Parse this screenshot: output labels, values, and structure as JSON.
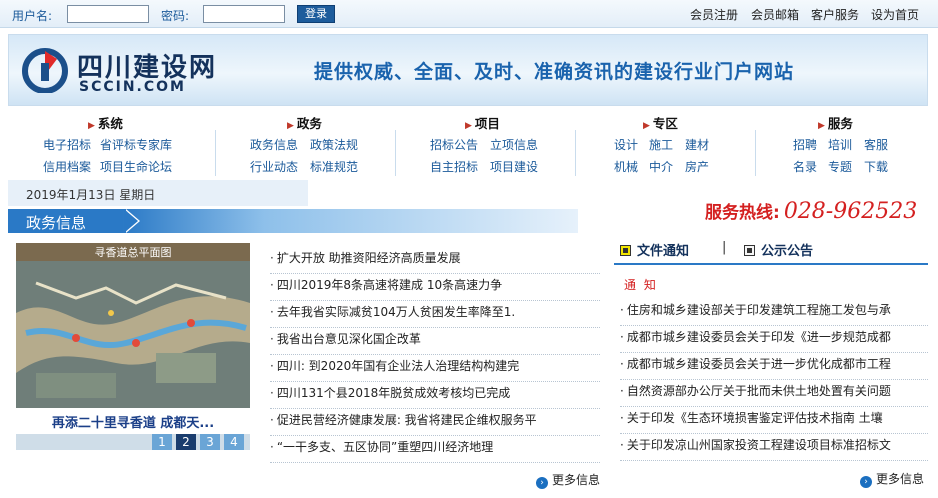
{
  "topbar": {
    "username_label": "用户名:",
    "password_label": "密码:",
    "login_label": "登录",
    "links": [
      "会员注册",
      "会员邮箱",
      "客户服务",
      "设为首页"
    ]
  },
  "banner": {
    "logo_cn": "四川建设网",
    "logo_en": "SCCIN.COM",
    "slogan": "提供权威、全面、及时、准确资讯的建设行业门户网站"
  },
  "nav": {
    "system": {
      "title": "系统",
      "links": [
        "电子招标",
        "省评标专家库",
        "信用档案",
        "项目生命论坛"
      ]
    },
    "gov": {
      "title": "政务",
      "links": [
        "政务信息",
        "政策法规",
        "行业动态",
        "标准规范"
      ]
    },
    "project": {
      "title": "项目",
      "links": [
        "招标公告",
        "立项信息",
        "自主招标",
        "项目建设"
      ]
    },
    "zone": {
      "title": "专区",
      "links": [
        "设计",
        "施工",
        "建材",
        "机械",
        "中介",
        "房产"
      ]
    },
    "service": {
      "title": "服务",
      "links": [
        "招聘",
        "培训",
        "客服",
        "名录",
        "专题",
        "下载"
      ]
    }
  },
  "date": "2019年1月13日  星期日",
  "section_title": "政务信息",
  "hotline": {
    "label": "服务热线:",
    "number": "028-962523"
  },
  "photo": {
    "map_title": "寻香道总平面图",
    "caption": "再添二十里寻香道 成都天...",
    "pages": [
      "1",
      "2",
      "3",
      "4"
    ],
    "active_page": 2
  },
  "news": [
    "扩大开放 助推资阳经济高质量发展",
    "四川2019年8条高速将建成 10条高速力争",
    "去年我省实际减贫104万人贫困发生率降至1.",
    "我省出台意见深化国企改革",
    "四川: 到2020年国有企业法人治理结构构建完",
    "四川131个县2018年脱贫成效考核均已完成",
    "促进民营经济健康发展: 我省将建民企维权服务平",
    "“一干多支、五区协同”重塑四川经济地理"
  ],
  "news_more": "更多信息",
  "tabs": [
    "文件通知",
    "公示公告"
  ],
  "tab_separator": "|",
  "notice_head": "通 知",
  "notices": [
    "住房和城乡建设部关于印发建筑工程施工发包与承",
    "成都市城乡建设委员会关于印发《进一步规范成都",
    "成都市城乡建设委员会关于进一步优化成都市工程",
    "自然资源部办公厅关于批而未供土地处置有关问题",
    "关于印发《生态环境损害鉴定评估技术指南 土壤",
    "关于印发凉山州国家投资工程建设项目标准招标文"
  ],
  "notices_more": "更多信息",
  "colors": {
    "brand": "#1b5a9a",
    "accent": "#2a79c6",
    "hotline": "#d42020"
  }
}
